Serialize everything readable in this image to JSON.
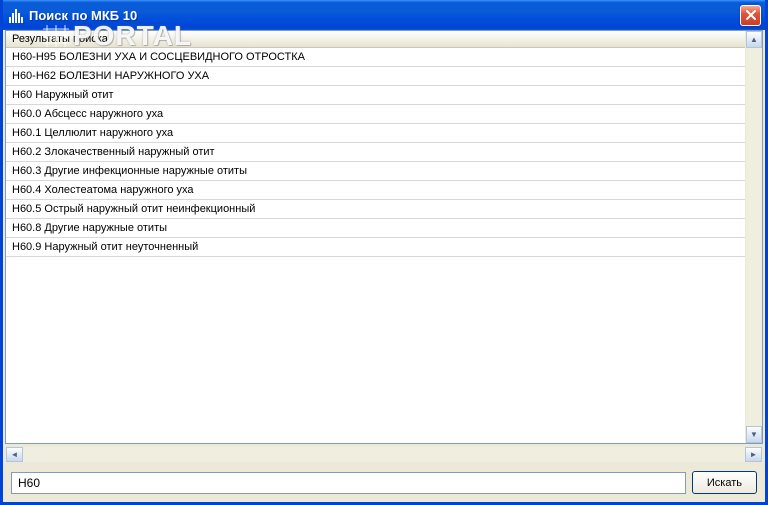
{
  "window": {
    "title": "Поиск по МКБ 10"
  },
  "watermark": "PORTAL",
  "results": {
    "header": "Результаты поиска",
    "rows": [
      "H60-H95 БОЛЕЗНИ УХА И СОСЦЕВИДНОГО ОТРОСТКА",
      "H60-H62 БОЛЕЗНИ НАРУЖНОГО УХА",
      "H60 Наружный отит",
      "H60.0 Абсцесс наружного уха",
      "H60.1 Целлюлит наружного уха",
      "H60.2 Злокачественный наружный отит",
      "H60.3 Другие инфекционные наружные отиты",
      "H60.4 Холестеатома наружного уха",
      "H60.5 Острый наружный отит неинфекционный",
      "H60.8 Другие наружные отиты",
      "H60.9 Наружный отит неуточненный"
    ]
  },
  "search": {
    "value": "H60",
    "button": "Искать"
  }
}
